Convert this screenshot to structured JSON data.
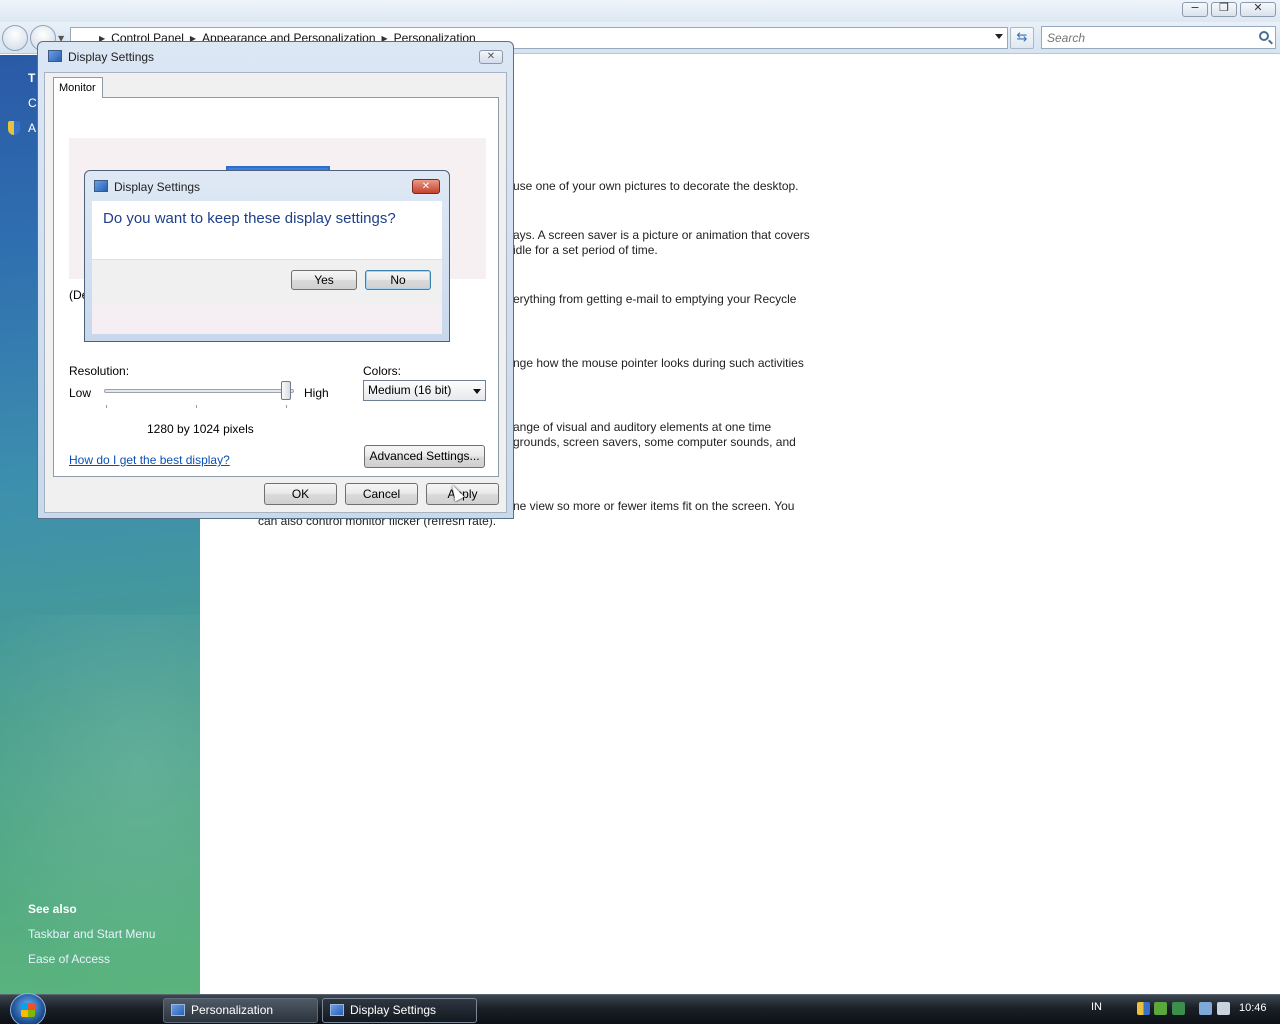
{
  "explorer": {
    "breadcrumbs": [
      "Control Panel",
      "Appearance and Personalization",
      "Personalization"
    ],
    "search_placeholder": "Search",
    "caption": {
      "minimize": "−",
      "maximize": "❐",
      "close": "✕"
    }
  },
  "left_pane": {
    "tasks": [
      "T",
      "C",
      "A"
    ],
    "see_also_title": "See also",
    "see_also_links": [
      "Taskbar and Start Menu",
      "Ease of Access"
    ]
  },
  "content_lines": [
    "use one of your own pictures to decorate the desktop.",
    "ays. A screen saver is a picture or animation that covers",
    "idle for a set period of time.",
    "erything from getting e-mail to emptying your Recycle",
    "nge how the mouse pointer looks during such activities",
    "ange of visual and auditory elements at one time",
    "grounds, screen savers, some computer sounds, and",
    "ne view so more or fewer items fit on the screen. You",
    "can also control monitor flicker (refresh rate)."
  ],
  "display_settings": {
    "title": "Display Settings",
    "tab": "Monitor",
    "detect_label": "(De",
    "resolution_label": "Resolution:",
    "low_label": "Low",
    "high_label": "High",
    "resolution_value": "1280 by 1024 pixels",
    "resolution_slider_fraction": 1.0,
    "colors_label": "Colors:",
    "colors_selected": "Medium (16 bit)",
    "help_link": "How do I get the best display?",
    "advanced_button": "Advanced Settings...",
    "ok_button": "OK",
    "cancel_button": "Cancel",
    "apply_button": "Apply"
  },
  "confirm_dialog": {
    "title": "Display Settings",
    "question": "Do you want to keep these display settings?",
    "yes_button": "Yes",
    "no_button": "No",
    "close_glyph": "✕"
  },
  "taskbar": {
    "buttons": [
      "Personalization",
      "Display Settings"
    ],
    "language": "IN",
    "time": "10:46"
  }
}
